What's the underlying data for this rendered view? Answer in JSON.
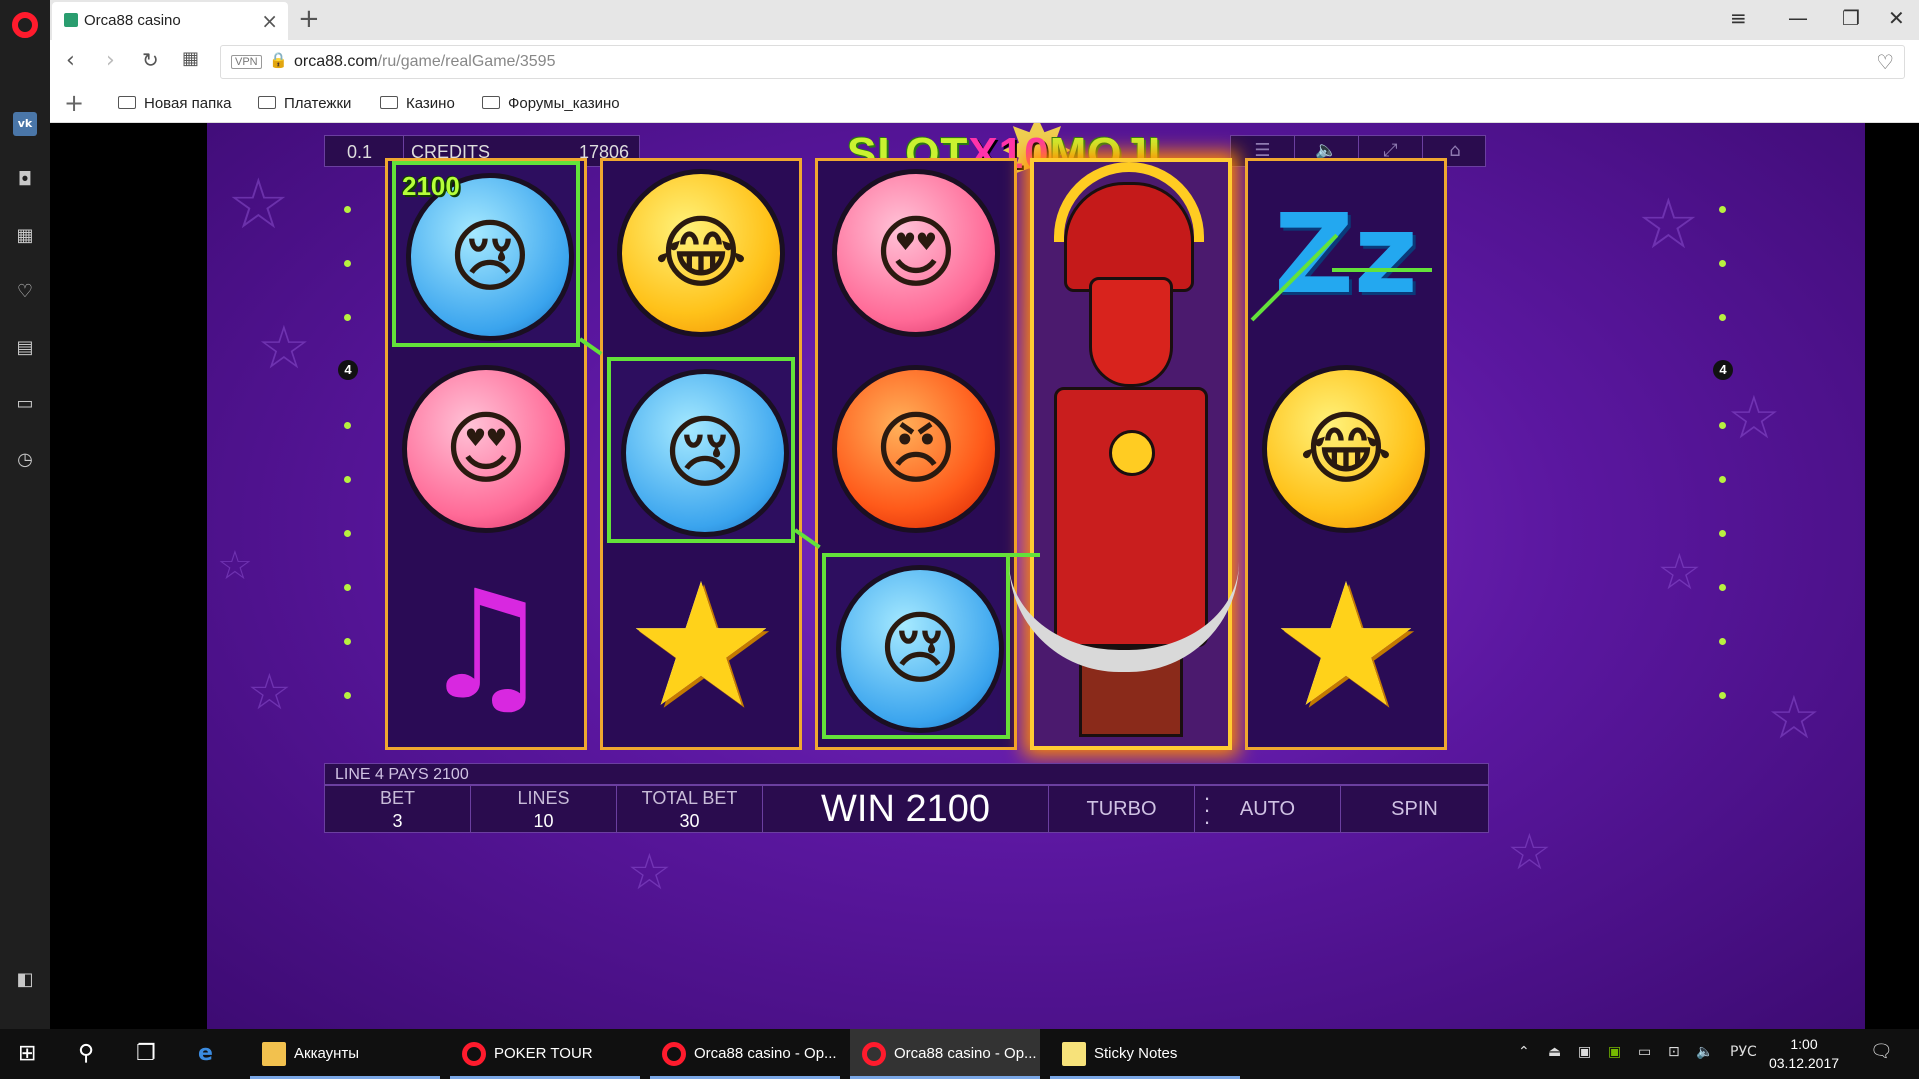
{
  "browser": {
    "tab_title": "Orca88 casino",
    "url_host": "orca88.com",
    "url_path": "/ru/game/realGame/3595",
    "vpn_label": "VPN",
    "bookmarks": [
      "Новая папка",
      "Платежки",
      "Казино",
      "Форумы_казино"
    ]
  },
  "game": {
    "title_left": "SLOT",
    "title_mid": "X10",
    "title_right": "MOJI",
    "denomination": "0.1",
    "credits_label": "CREDITS",
    "credits_value": "17806",
    "line_left": "4",
    "line_right": "4",
    "symbol_win_amount": "2100",
    "message": "LINE 4 PAYS 2100",
    "bet_label": "BET",
    "bet_value": "3",
    "lines_label": "LINES",
    "lines_value": "10",
    "total_bet_label": "TOTAL BET",
    "total_bet_value": "30",
    "win_text": "WIN 2100",
    "turbo_label": "TURBO",
    "auto_label": "AUTO",
    "spin_label": "SPIN",
    "reels": [
      [
        "crying-face",
        "heart-eyes-face",
        "music-note"
      ],
      [
        "laughing-face",
        "crying-face",
        "star"
      ],
      [
        "heart-eyes-face",
        "angry-face",
        "crying-face"
      ],
      [
        "samurai-wild"
      ],
      [
        "sleeping-zzz",
        "laughing-face",
        "star"
      ]
    ]
  },
  "taskbar": {
    "apps": [
      "Аккаунты",
      "POKER TOUR CASI...",
      "Orca88 casino - Op...",
      "Orca88 casino - Op...",
      "Sticky Notes"
    ],
    "lang": "РУС",
    "time": "1:00",
    "date": "03.12.2017"
  }
}
